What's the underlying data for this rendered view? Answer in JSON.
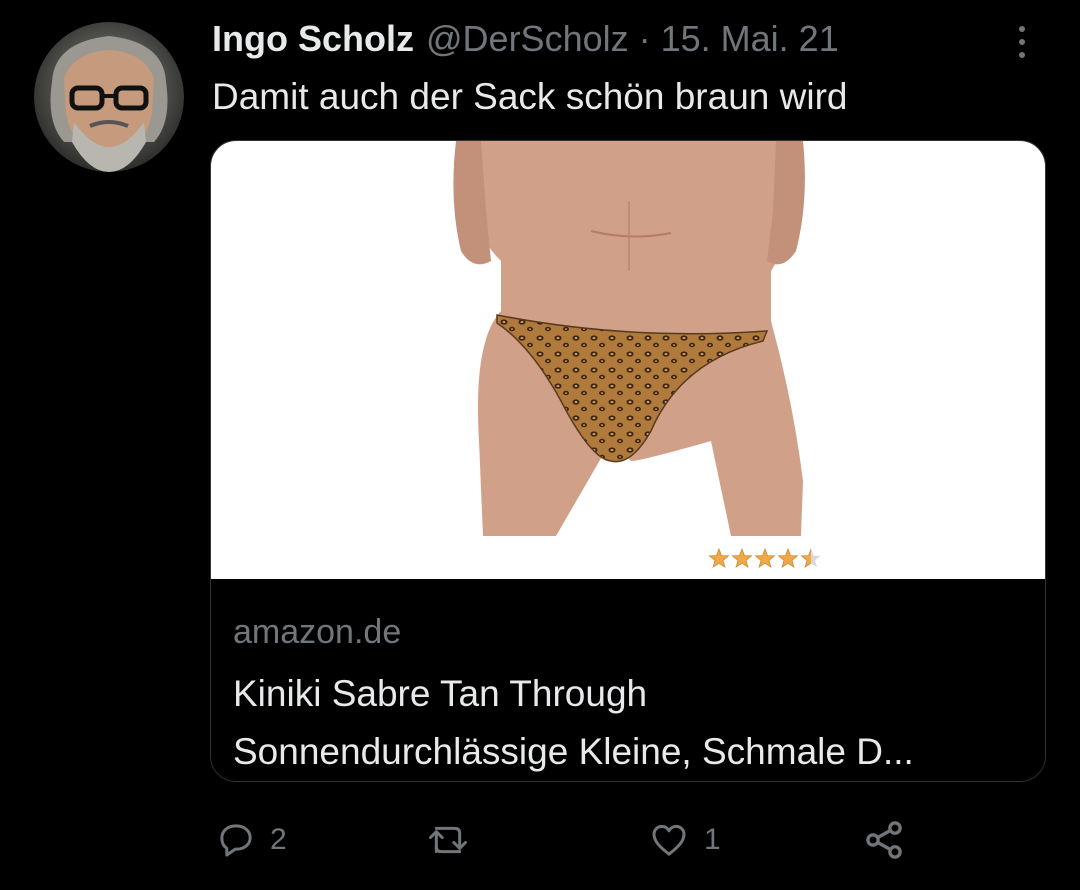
{
  "tweet": {
    "author_name": "Ingo Scholz",
    "handle": "@DerScholz",
    "separator": "·",
    "date": "15. Mai. 21",
    "text": "Damit auch der Sack schön braun wird"
  },
  "card": {
    "domain": "amazon.de",
    "title_line1": "Kiniki Sabre Tan Through",
    "title_line2": "Sonnendurchlässige Kleine, Schmale D...",
    "rating_stars": 4.5,
    "rating_max": 5
  },
  "actions": {
    "reply_count": "2",
    "retweet_count": "",
    "like_count": "1"
  },
  "icons": {
    "more": "more-vertical-icon",
    "reply": "reply-icon",
    "retweet": "retweet-icon",
    "like": "heart-icon",
    "share": "share-icon"
  },
  "colors": {
    "background": "#000000",
    "text_primary": "#e7e9ea",
    "text_secondary": "#71767b",
    "star": "#f3a847"
  }
}
